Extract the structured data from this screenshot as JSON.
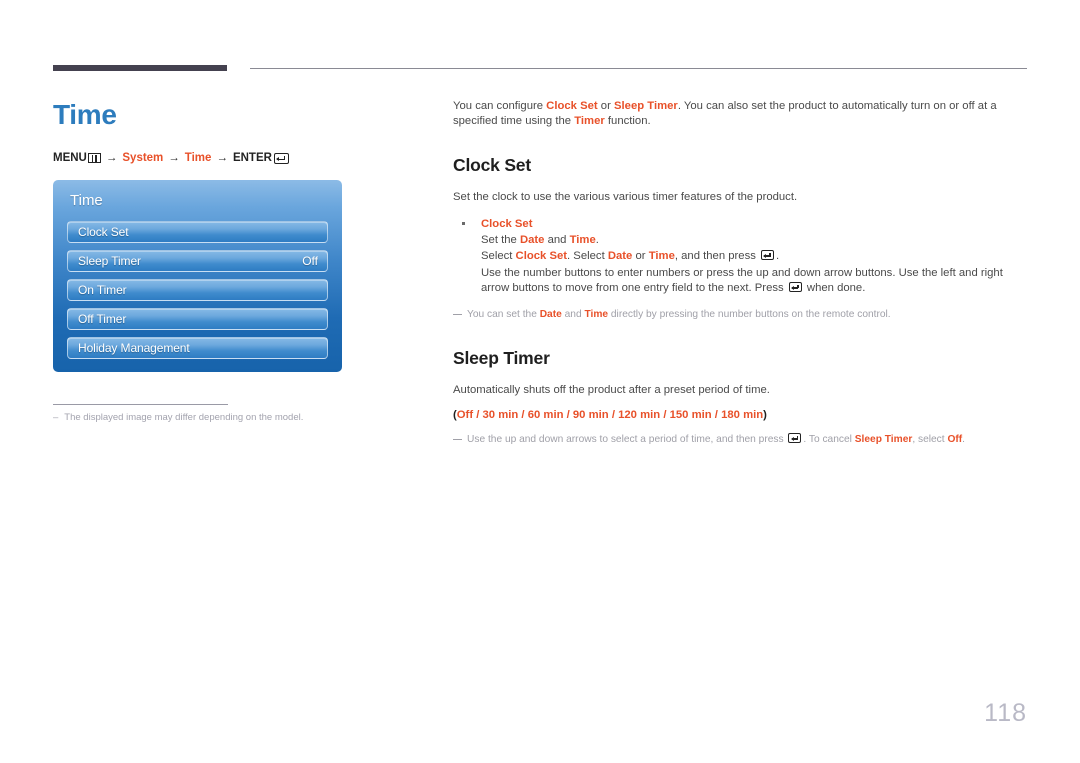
{
  "page": {
    "title": "Time",
    "number": "118",
    "breadcrumb": {
      "menu_label": "MENU",
      "menu_icon": "menu-grid-icon",
      "arrow": "→",
      "item1": "System",
      "item2": "Time",
      "enter_label": "ENTER",
      "enter_icon": "enter-return-icon"
    }
  },
  "osd": {
    "title": "Time",
    "items": [
      {
        "label": "Clock Set",
        "value": ""
      },
      {
        "label": "Sleep Timer",
        "value": "Off"
      },
      {
        "label": "On Timer",
        "value": ""
      },
      {
        "label": "Off Timer",
        "value": ""
      },
      {
        "label": "Holiday Management",
        "value": ""
      }
    ]
  },
  "left_footnote": {
    "dash": "–",
    "text": "The displayed image may differ depending on the model."
  },
  "intro": {
    "t1": "You can configure ",
    "a1": "Clock Set",
    "t2": " or ",
    "a2": "Sleep Timer",
    "t3": ". You can also set the product to automatically turn on or off at a specified time using the ",
    "a3": "Timer",
    "t4": " function."
  },
  "clock_set": {
    "heading": "Clock Set",
    "body": "Set the clock to use the various various timer features of the product.",
    "bullet_title": "Clock Set",
    "line1_a": "Set the ",
    "line1_b": "Date",
    "line1_c": " and ",
    "line1_d": "Time",
    "line1_e": ".",
    "line2_a": "Select ",
    "line2_b": "Clock Set",
    "line2_c": ". Select ",
    "line2_d": "Date",
    "line2_e": " or ",
    "line2_f": "Time",
    "line2_g": ", and then press ",
    "line2_h": ".",
    "para_a": "Use the number buttons to enter numbers or press the up and down arrow buttons. Use the left and right arrow buttons to move from one entry field to the next. Press ",
    "para_b": " when done.",
    "note_a": "You can set the ",
    "note_b": "Date",
    "note_c": " and ",
    "note_d": "Time",
    "note_e": " directly by pressing the number buttons on the remote control."
  },
  "sleep_timer": {
    "heading": "Sleep Timer",
    "body": "Automatically shuts off the product after a preset period of time.",
    "open_paren": "(",
    "options": "Off / 30 min / 60 min / 90 min / 120 min / 150 min / 180 min",
    "close_paren": ")",
    "note_a": "Use the up and down arrows to select a period of time, and then press ",
    "note_b": ". To cancel ",
    "note_c": "Sleep Timer",
    "note_d": ", select ",
    "note_e": "Off",
    "note_f": "."
  },
  "colors": {
    "accent": "#e8512a",
    "title_blue": "#2d7cbd",
    "rule_dark": "#44414f",
    "page_number": "#b9b9c6"
  }
}
